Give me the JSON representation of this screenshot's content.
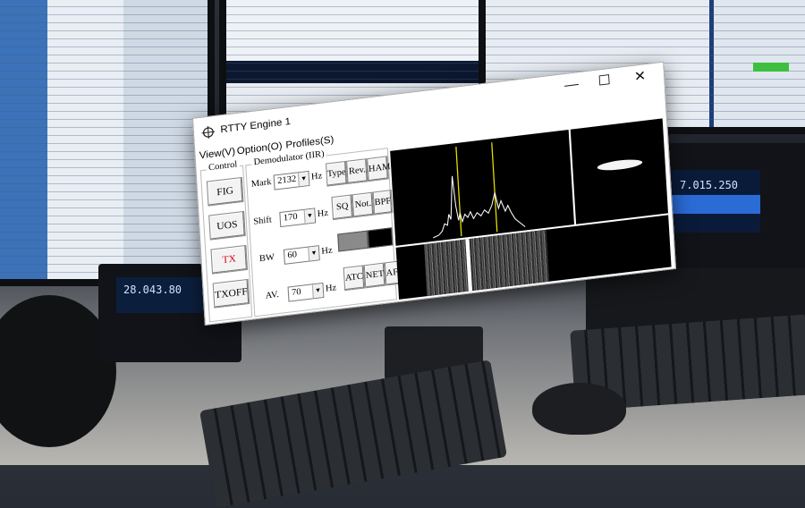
{
  "window": {
    "title": "RTTY Engine 1",
    "minimize_glyph": "—",
    "maximize_glyph": "☐",
    "close_glyph": "✕"
  },
  "menu": [
    "View(V)",
    "Option(O)",
    "Profiles(S)"
  ],
  "control": {
    "title": "Control",
    "buttons": [
      "FIG",
      "UOS",
      "TX",
      "TXOFF"
    ]
  },
  "demodulator": {
    "title": "Demodulator (IIR)",
    "mark": {
      "label": "Mark",
      "value": "2132",
      "unit": "Hz"
    },
    "shift": {
      "label": "Shift",
      "value": "170",
      "unit": "Hz"
    },
    "bw": {
      "label": "BW",
      "value": "60",
      "unit": "Hz"
    },
    "av": {
      "label": "AV.",
      "value": "70",
      "unit": "Hz"
    },
    "buttons": {
      "type": "Type",
      "rev": "Rev.",
      "ham": "HAM",
      "sq": "SQ",
      "not": "Not.",
      "bpf": "BPF",
      "atc": "ATC",
      "net": "NET",
      "afc": "AFC"
    }
  },
  "colors": {
    "tx_red": "#d8000c",
    "marker_yellow": "#e8e000",
    "level_gray": "#8a8a8a"
  },
  "background": {
    "radio_right_readout": "7.015.250",
    "radio_left_readout": "28.043.80"
  }
}
